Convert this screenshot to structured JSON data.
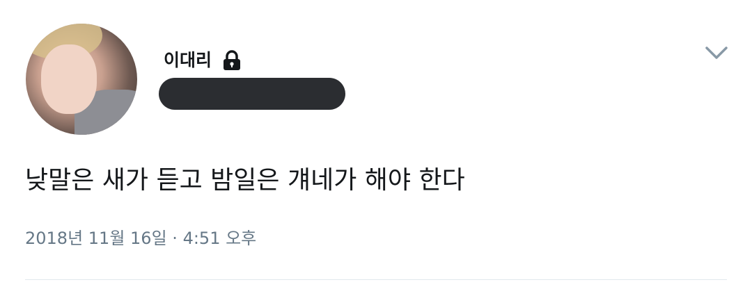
{
  "user": {
    "display_name": "이대리",
    "protected_icon": "lock-icon"
  },
  "tweet": {
    "text": "낮말은 새가 듣고 밤일은 걔네가 해야 한다",
    "date": "2018년 11월 16일",
    "separator": "·",
    "time": "4:51 오후"
  },
  "menu": {
    "icon": "chevron-down-icon"
  },
  "colors": {
    "text_primary": "#14171a",
    "text_secondary": "#657786",
    "redaction": "#2b2d31",
    "divider": "#e1e8ed"
  }
}
